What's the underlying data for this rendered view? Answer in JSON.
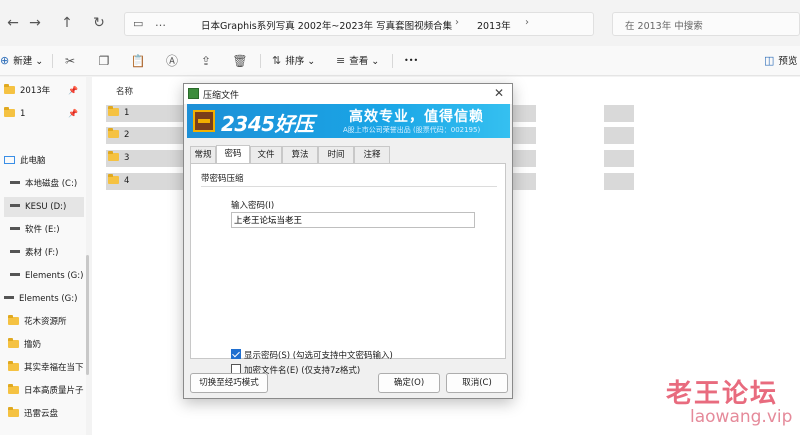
{
  "explorer": {
    "address_segments": [
      "日本Graphis系列写真 2002年~2023年 写真套图视频合集",
      "2013年"
    ],
    "search_placeholder": "在 2013年 中搜索",
    "toolbar": {
      "new_label": "新建",
      "sort_label": "排序",
      "view_label": "查看",
      "more_label": "•••",
      "preview_label": "预览"
    },
    "sidebar": {
      "quick": [
        {
          "label": "2013年",
          "pinned": true
        },
        {
          "label": "1",
          "pinned": true
        }
      ],
      "this_pc": "此电脑",
      "drives": [
        {
          "label": "本地磁盘 (C:)",
          "selected": false
        },
        {
          "label": "KESU (D:)",
          "selected": true
        },
        {
          "label": "软件 (E:)",
          "selected": false
        },
        {
          "label": "素材 (F:)",
          "selected": false
        },
        {
          "label": "Elements (G:)",
          "selected": false
        }
      ],
      "elements_root": "Elements (G:)",
      "folders": [
        "花木资源所",
        "撸奶",
        "其实幸福在当下",
        "日本高质量片子",
        "迅雷云盘"
      ]
    },
    "column_name": "名称",
    "files": [
      "1",
      "2",
      "3",
      "4"
    ]
  },
  "dialog": {
    "title": "压缩文件",
    "brand": "2345好压",
    "slogan": "高效专业，值得信赖",
    "subtitle": "A股上市公司荣誉出品 (股票代码：002195)",
    "tabs": [
      "常规",
      "密码",
      "文件",
      "算法",
      "时间",
      "注释"
    ],
    "active_tab": "密码",
    "group_title": "带密码压缩",
    "password_label": "输入密码(I)",
    "password_value": "上老王论坛当老王",
    "show_password": {
      "label": "显示密码(S)  (勾选可支持中文密码输入)",
      "checked": true
    },
    "encrypt_names": {
      "label": "加密文件名(E)  (仅支持7z格式)",
      "checked": false
    },
    "switch_mode_label": "切换至经巧模式",
    "ok_label": "确定(O)",
    "cancel_label": "取消(C)"
  },
  "watermark": {
    "line1": "老王论坛",
    "line2": "laowang.vip"
  }
}
